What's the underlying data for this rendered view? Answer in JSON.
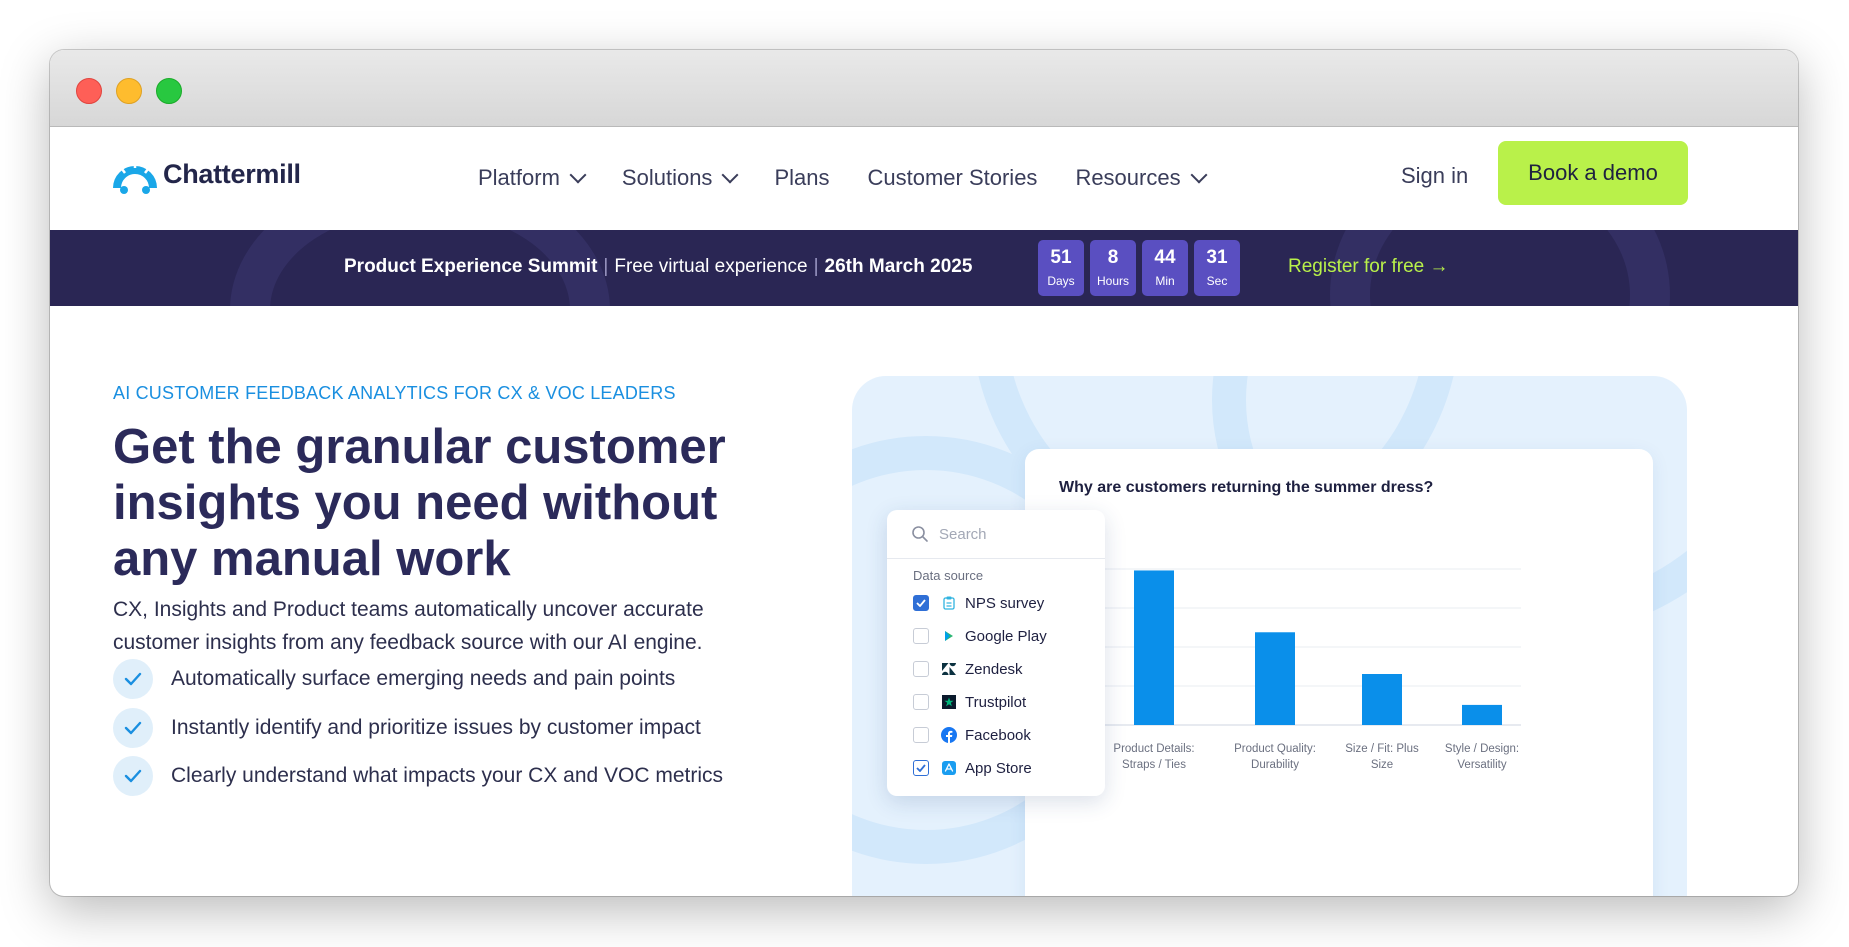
{
  "window": {
    "controls": [
      "close",
      "minimize",
      "maximize"
    ]
  },
  "nav": {
    "logo_text": "Chattermill",
    "menu": [
      {
        "label": "Platform",
        "has_dropdown": true
      },
      {
        "label": "Solutions",
        "has_dropdown": true
      },
      {
        "label": "Plans",
        "has_dropdown": false
      },
      {
        "label": "Customer Stories",
        "has_dropdown": false
      },
      {
        "label": "Resources",
        "has_dropdown": true
      }
    ],
    "sign_in": "Sign in",
    "cta": "Book a demo"
  },
  "banner": {
    "event": "Product Experience Summit",
    "separator": "|",
    "desc": "Free virtual experience",
    "date": "26th March 2025",
    "countdown": [
      {
        "value": "51",
        "unit": "Days"
      },
      {
        "value": "8",
        "unit": "Hours"
      },
      {
        "value": "44",
        "unit": "Min"
      },
      {
        "value": "31",
        "unit": "Sec"
      }
    ],
    "register": "Register for free →"
  },
  "hero": {
    "eyebrow": "AI CUSTOMER FEEDBACK ANALYTICS FOR CX & VOC LEADERS",
    "headline": "Get the granular customer insights you need without any manual work",
    "subtext": "CX, Insights and Product teams automatically uncover accurate customer insights from any feedback source with our AI engine.",
    "bullets": [
      "Automatically surface emerging needs and pain points",
      "Instantly identify and prioritize issues by customer impact",
      "Clearly understand what impacts your CX and VOC metrics"
    ]
  },
  "filter": {
    "search_placeholder": "Search",
    "section_label": "Data source",
    "sources": [
      {
        "label": "NPS survey",
        "checked": true,
        "icon": "clipboard-icon"
      },
      {
        "label": "Google Play",
        "checked": false,
        "icon": "google-play-icon"
      },
      {
        "label": "Zendesk",
        "checked": false,
        "icon": "zendesk-icon"
      },
      {
        "label": "Trustpilot",
        "checked": false,
        "icon": "trustpilot-icon"
      },
      {
        "label": "Facebook",
        "checked": false,
        "icon": "facebook-icon"
      },
      {
        "label": "App Store",
        "checked": true,
        "icon": "app-store-icon"
      }
    ]
  },
  "colors": {
    "brand_dark": "#2a2654",
    "accent_lime": "#b9f14a",
    "accent_blue": "#0a8fea",
    "countdown_box": "#5a4fc1"
  },
  "chart_data": {
    "type": "bar",
    "title": "Why are customers returning the summer dress?",
    "categories": [
      [
        "Product Details:",
        "Straps / Ties"
      ],
      [
        "Product Quality:",
        "Durability"
      ],
      [
        "Size / Fit: Plus",
        "Size"
      ],
      [
        "Style / Design:",
        "Versatility"
      ]
    ],
    "values": [
      100,
      60,
      33,
      13
    ],
    "ylim": [
      0,
      110
    ],
    "grid": true,
    "bar_color": "#0a8fea"
  }
}
